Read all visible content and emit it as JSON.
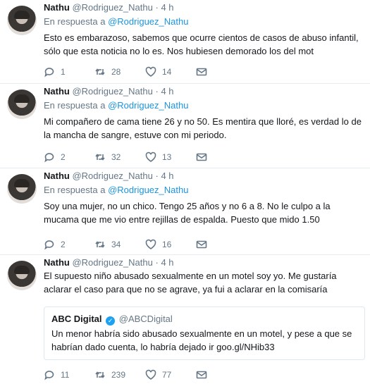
{
  "tweets": [
    {
      "name": "Nathu",
      "handle": "@Rodriguez_Nathu",
      "dot": "·",
      "time": "4 h",
      "reply_prefix": "En respuesta a",
      "reply_to": "@Rodriguez_Nathu",
      "text": "Esto es embarazoso, sabemos que ocurre cientos de casos de abuso infantil, sólo que esta noticia no lo es. Nos hubiesen demorado los del mot",
      "replies": "1",
      "retweets": "28",
      "likes": "14"
    },
    {
      "name": "Nathu",
      "handle": "@Rodriguez_Nathu",
      "dot": "·",
      "time": "4 h",
      "reply_prefix": "En respuesta a",
      "reply_to": "@Rodriguez_Nathu",
      "text": "Mi compañero de cama tiene 26 y no 50. Es mentira que lloré, es verdad lo de la mancha de sangre, estuve con mi periodo.",
      "replies": "2",
      "retweets": "32",
      "likes": "13"
    },
    {
      "name": "Nathu",
      "handle": "@Rodriguez_Nathu",
      "dot": "·",
      "time": "4 h",
      "reply_prefix": "En respuesta a",
      "reply_to": "@Rodriguez_Nathu",
      "text": "Soy una mujer, no un chico. Tengo 25 años y no 6 a 8. No le culpo a la mucama que me vio entre rejillas de espalda. Puesto que mido 1.50",
      "replies": "2",
      "retweets": "34",
      "likes": "16"
    },
    {
      "name": "Nathu",
      "handle": "@Rodriguez_Nathu",
      "dot": "·",
      "time": "4 h",
      "text": "El supuesto niño abusado sexualmente en un motel soy yo. Me gustaría aclarar el caso para que no se agrave, ya fui a aclarar en la comisaría",
      "quote": {
        "name": "ABC Digital",
        "handle": "@ABCDigital",
        "text": "Un menor habría sido abusado sexualmente en un motel, y pese a que se habrían dado cuenta, lo habría dejado ir goo.gl/NHib33"
      },
      "replies": "11",
      "retweets": "239",
      "likes": "77"
    }
  ],
  "icons": {
    "reply": "reply-icon",
    "retweet": "retweet-icon",
    "like": "heart-icon",
    "message": "envelope-icon",
    "verified": "verified-badge-icon"
  },
  "colors": {
    "link": "#1b95e0",
    "muted": "#657786",
    "text": "#14171a",
    "border": "#e6ecf0",
    "verified": "#1da1f2"
  }
}
